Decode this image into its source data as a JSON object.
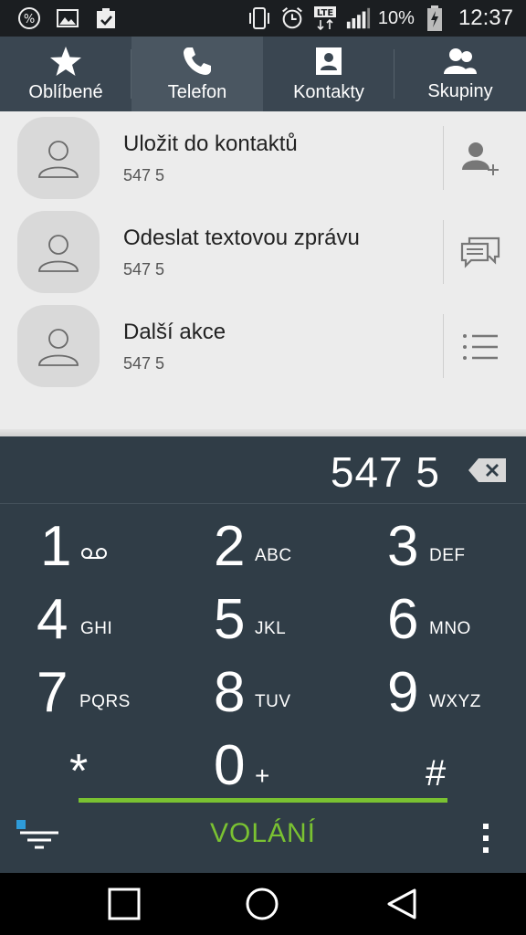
{
  "status_bar": {
    "icons_left": [
      "percent-icon",
      "image-icon",
      "clipboard-check-icon"
    ],
    "icons_right": [
      "vibrate-icon",
      "alarm-icon",
      "lte-icon",
      "signal-icon",
      "battery-charging-icon"
    ],
    "battery": "10%",
    "time": "12:37"
  },
  "tabs": [
    {
      "label": "Oblíbené",
      "icon": "star-icon"
    },
    {
      "label": "Telefon",
      "icon": "phone-icon",
      "active": true
    },
    {
      "label": "Kontakty",
      "icon": "contact-card-icon"
    },
    {
      "label": "Skupiny",
      "icon": "group-icon"
    }
  ],
  "list": [
    {
      "title": "Uložit do kontaktů",
      "subtitle": "547 5",
      "action_icon": "add-contact-icon"
    },
    {
      "title": "Odeslat textovou zprávu",
      "subtitle": "547 5",
      "action_icon": "message-icon"
    },
    {
      "title": "Další akce",
      "subtitle": "547 5",
      "action_icon": "list-icon"
    }
  ],
  "dialer": {
    "number": "547 5",
    "keys": [
      {
        "num": "1",
        "letters": "ꝏ"
      },
      {
        "num": "2",
        "letters": "ABC"
      },
      {
        "num": "3",
        "letters": "DEF"
      },
      {
        "num": "4",
        "letters": "GHI"
      },
      {
        "num": "5",
        "letters": "JKL"
      },
      {
        "num": "6",
        "letters": "MNO"
      },
      {
        "num": "7",
        "letters": "PQRS"
      },
      {
        "num": "8",
        "letters": "TUV"
      },
      {
        "num": "9",
        "letters": "WXYZ"
      },
      {
        "num": "*",
        "letters": ""
      },
      {
        "num": "0",
        "letters": "+"
      },
      {
        "num": "#",
        "letters": ""
      }
    ],
    "call_label": "VOLÁNÍ",
    "accent": "#7ac232"
  },
  "nav": [
    "recents-icon",
    "home-icon",
    "back-icon"
  ]
}
